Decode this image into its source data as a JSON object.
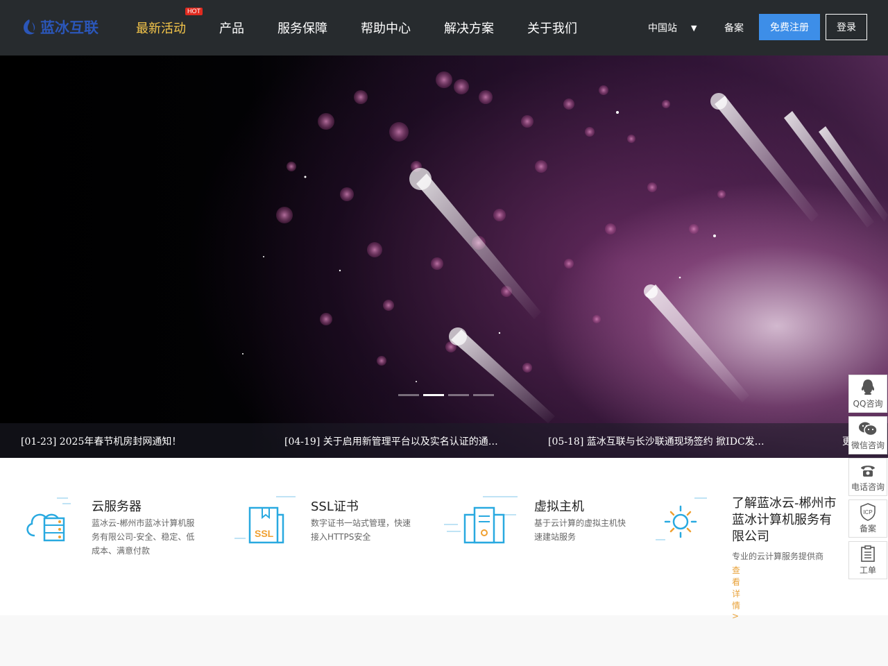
{
  "header": {
    "logo_text": "蓝冰互联",
    "nav": [
      {
        "label": "最新活动",
        "badge": "HOT",
        "active": true
      },
      {
        "label": "产品"
      },
      {
        "label": "服务保障"
      },
      {
        "label": "帮助中心"
      },
      {
        "label": "解决方案"
      },
      {
        "label": "关于我们"
      }
    ],
    "site_select": "中国站",
    "site_caret": "▼",
    "beian": "备案",
    "register": "免费注册",
    "login": "登录"
  },
  "hero": {
    "active_slide": 2,
    "slide_count": 4,
    "news": [
      "[01-23] 2025年春节机房封网通知！",
      "[04-19] 关于启用新管理平台以及实名认证的通…",
      "[05-18] 蓝冰互联与长沙联通现场签约 掀IDC发…",
      "更"
    ]
  },
  "features": [
    {
      "title": "云服务器",
      "desc": "蓝冰云-郴州市蓝冰计算机服务有限公司-安全、稳定、低成本、满意付款",
      "icon": "cloud-server-icon"
    },
    {
      "title": "SSL证书",
      "desc": "数字证书一站式管理，快速接入HTTPS安全",
      "icon": "ssl-certificate-icon",
      "icon_text": "SSL"
    },
    {
      "title": "虚拟主机",
      "desc": "基于云计算的虚拟主机快速建站服务",
      "icon": "virtual-host-icon"
    },
    {
      "title": "了解蓝冰云-郴州市蓝冰计算机服务有限公司",
      "desc": "专业的云计算服务提供商",
      "link": "查看详情 >",
      "icon": "sun-icon"
    }
  ],
  "float_bar": [
    {
      "label": "QQ咨询",
      "icon": "qq-icon"
    },
    {
      "label": "微信咨询",
      "icon": "wechat-icon"
    },
    {
      "label": "电话咨询",
      "icon": "phone-icon"
    },
    {
      "label": "备案",
      "icon": "icp-icon",
      "icon_text": "ICP"
    },
    {
      "label": "工单",
      "icon": "ticket-icon"
    }
  ],
  "colors": {
    "header_bg": "#272b2e",
    "accent": "#3d8ee8",
    "nav_active": "#f5c64a",
    "hot": "#e02b20",
    "link_orange": "#e8a23a",
    "icon_cyan": "#29a9e0",
    "icon_orange": "#f0a030"
  }
}
